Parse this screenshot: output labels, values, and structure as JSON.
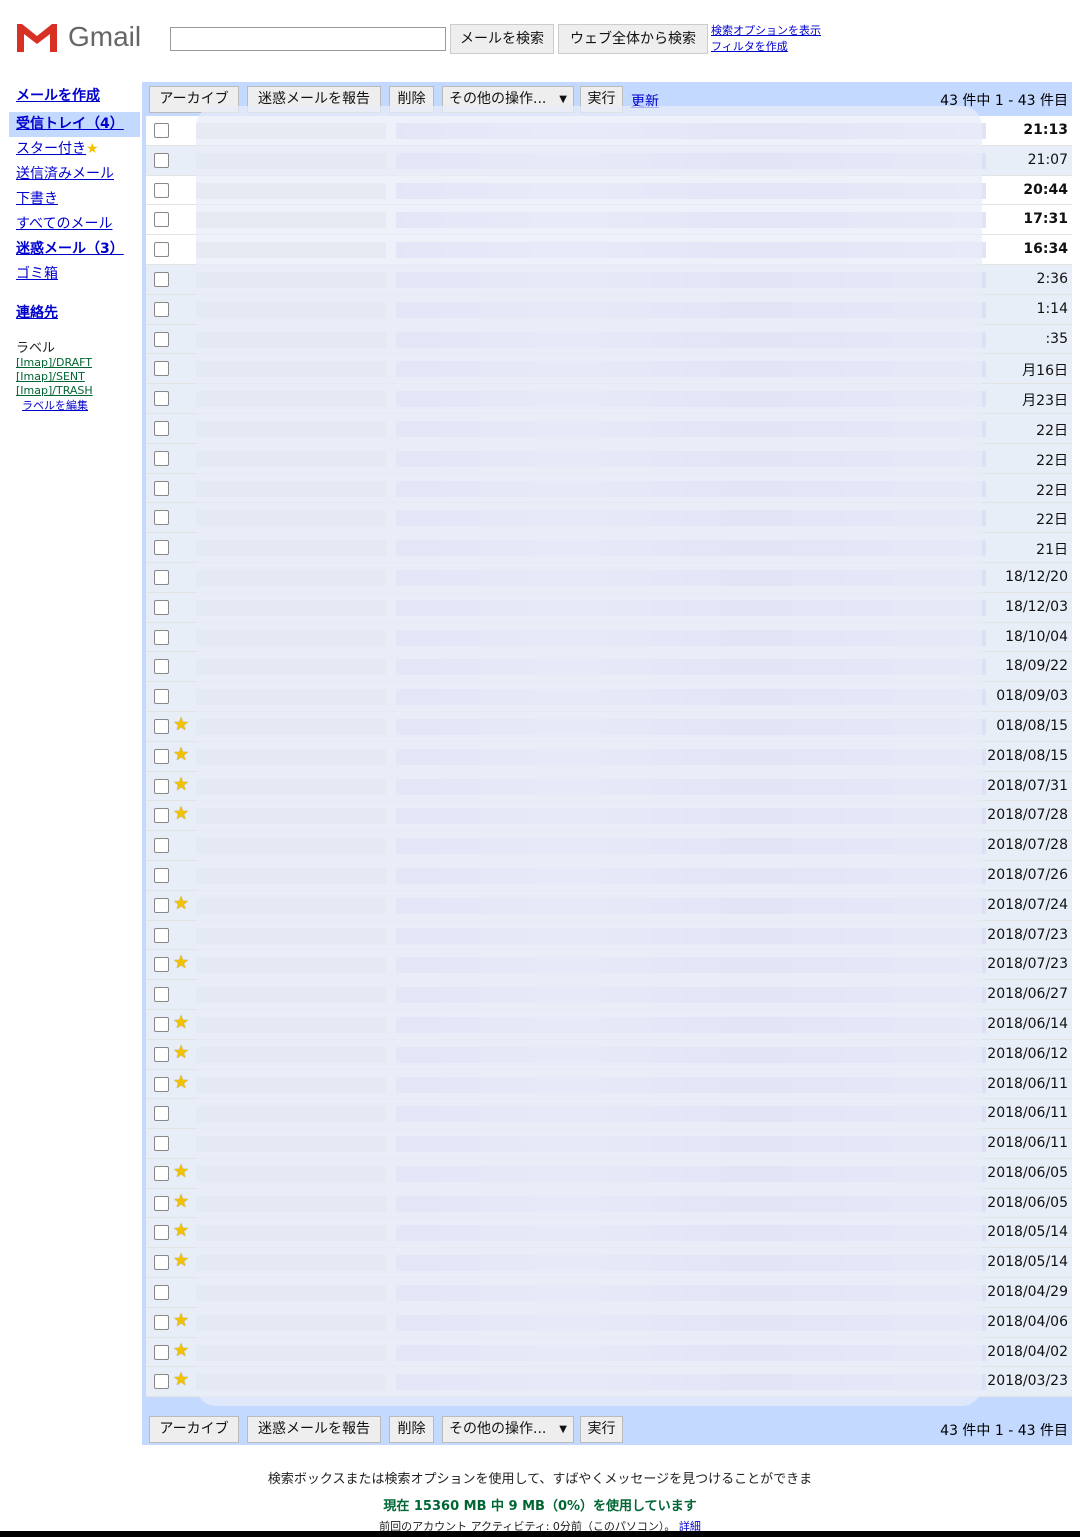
{
  "header": {
    "logo_text": "Gmail",
    "search_mail_button": "メールを検索",
    "search_web_button": "ウェブ全体から検索",
    "search_options_link": "検索オプションを表示",
    "create_filter_link": "フィルタを作成"
  },
  "sidebar": {
    "compose": "メールを作成",
    "nav": [
      {
        "label": "受信トレイ（4）"
      },
      {
        "label": "スター付き"
      },
      {
        "label": "送信済みメール"
      },
      {
        "label": "下書き"
      },
      {
        "label": "すべてのメール"
      },
      {
        "label": "迷惑メール（3）"
      },
      {
        "label": "ゴミ箱"
      }
    ],
    "contacts": "連絡先",
    "labels_title": "ラベル",
    "labels": [
      {
        "label": "[Imap]/DRAFT"
      },
      {
        "label": "[Imap]/SENT"
      },
      {
        "label": "[Imap]/TRASH"
      }
    ],
    "edit_labels": "ラベルを編集"
  },
  "toolbar": {
    "archive": "アーカイブ",
    "report_spam": "迷惑メールを報告",
    "delete": "削除",
    "more_actions": "その他の操作...",
    "execute": "実行",
    "refresh": "更新",
    "count_text": "43 件中 1 - 43 件目"
  },
  "emails": [
    {
      "date": "21:13",
      "starred": false,
      "unread": true
    },
    {
      "date": "21:07",
      "starred": false,
      "unread": false
    },
    {
      "date": "20:44",
      "starred": false,
      "unread": true
    },
    {
      "date": "17:31",
      "starred": false,
      "unread": true
    },
    {
      "date": "16:34",
      "starred": false,
      "unread": true
    },
    {
      "date": "2:36",
      "starred": false,
      "unread": false
    },
    {
      "date": "1:14",
      "starred": false,
      "unread": false
    },
    {
      "date": ":35",
      "starred": false,
      "unread": false
    },
    {
      "date": "月16日",
      "starred": false,
      "unread": false
    },
    {
      "date": "月23日",
      "starred": false,
      "unread": false
    },
    {
      "date": "22日",
      "starred": false,
      "unread": false
    },
    {
      "date": "22日",
      "starred": false,
      "unread": false
    },
    {
      "date": "22日",
      "starred": false,
      "unread": false
    },
    {
      "date": "22日",
      "starred": false,
      "unread": false
    },
    {
      "date": "21日",
      "starred": false,
      "unread": false
    },
    {
      "date": "18/12/20",
      "starred": false,
      "unread": false
    },
    {
      "date": "18/12/03",
      "starred": false,
      "unread": false
    },
    {
      "date": "18/10/04",
      "starred": false,
      "unread": false
    },
    {
      "date": "18/09/22",
      "starred": false,
      "unread": false
    },
    {
      "date": "018/09/03",
      "starred": false,
      "unread": false
    },
    {
      "date": "018/08/15",
      "starred": true,
      "unread": false
    },
    {
      "date": "2018/08/15",
      "starred": true,
      "unread": false
    },
    {
      "date": "2018/07/31",
      "starred": true,
      "unread": false
    },
    {
      "date": "2018/07/28",
      "starred": true,
      "unread": false
    },
    {
      "date": "2018/07/28",
      "starred": false,
      "unread": false
    },
    {
      "date": "2018/07/26",
      "starred": false,
      "unread": false
    },
    {
      "date": "2018/07/24",
      "starred": true,
      "unread": false
    },
    {
      "date": "2018/07/23",
      "starred": false,
      "unread": false
    },
    {
      "date": "2018/07/23",
      "starred": true,
      "unread": false
    },
    {
      "date": "2018/06/27",
      "starred": false,
      "unread": false
    },
    {
      "date": "2018/06/14",
      "starred": true,
      "unread": false
    },
    {
      "date": "2018/06/12",
      "starred": true,
      "unread": false
    },
    {
      "date": "2018/06/11",
      "starred": true,
      "unread": false
    },
    {
      "date": "2018/06/11",
      "starred": false,
      "unread": false
    },
    {
      "date": "2018/06/11",
      "starred": false,
      "unread": false
    },
    {
      "date": "2018/06/05",
      "starred": true,
      "unread": false
    },
    {
      "date": "2018/06/05",
      "starred": true,
      "unread": false
    },
    {
      "date": "2018/05/14",
      "starred": true,
      "unread": false
    },
    {
      "date": "2018/05/14",
      "starred": true,
      "unread": false
    },
    {
      "date": "2018/04/29",
      "starred": false,
      "unread": false
    },
    {
      "date": "2018/04/06",
      "starred": true,
      "unread": false
    },
    {
      "date": "2018/04/02",
      "starred": true,
      "unread": false
    },
    {
      "date": "2018/03/23",
      "starred": true,
      "unread": false
    }
  ],
  "footer": {
    "tip": "検索ボックスまたは検索オプションを使用して、すばやくメッセージを見つけることができま",
    "usage": "現在 15360 MB 中 9 MB（0%）を使用しています",
    "activity": "前回のアカウント アクティビティ: 0分前（このパソコン）。",
    "details_link": "詳細"
  },
  "colors": {
    "accent": "#c3d9ff",
    "link": "#0000cc",
    "usage_green": "#006633",
    "star": "#f2c200"
  }
}
